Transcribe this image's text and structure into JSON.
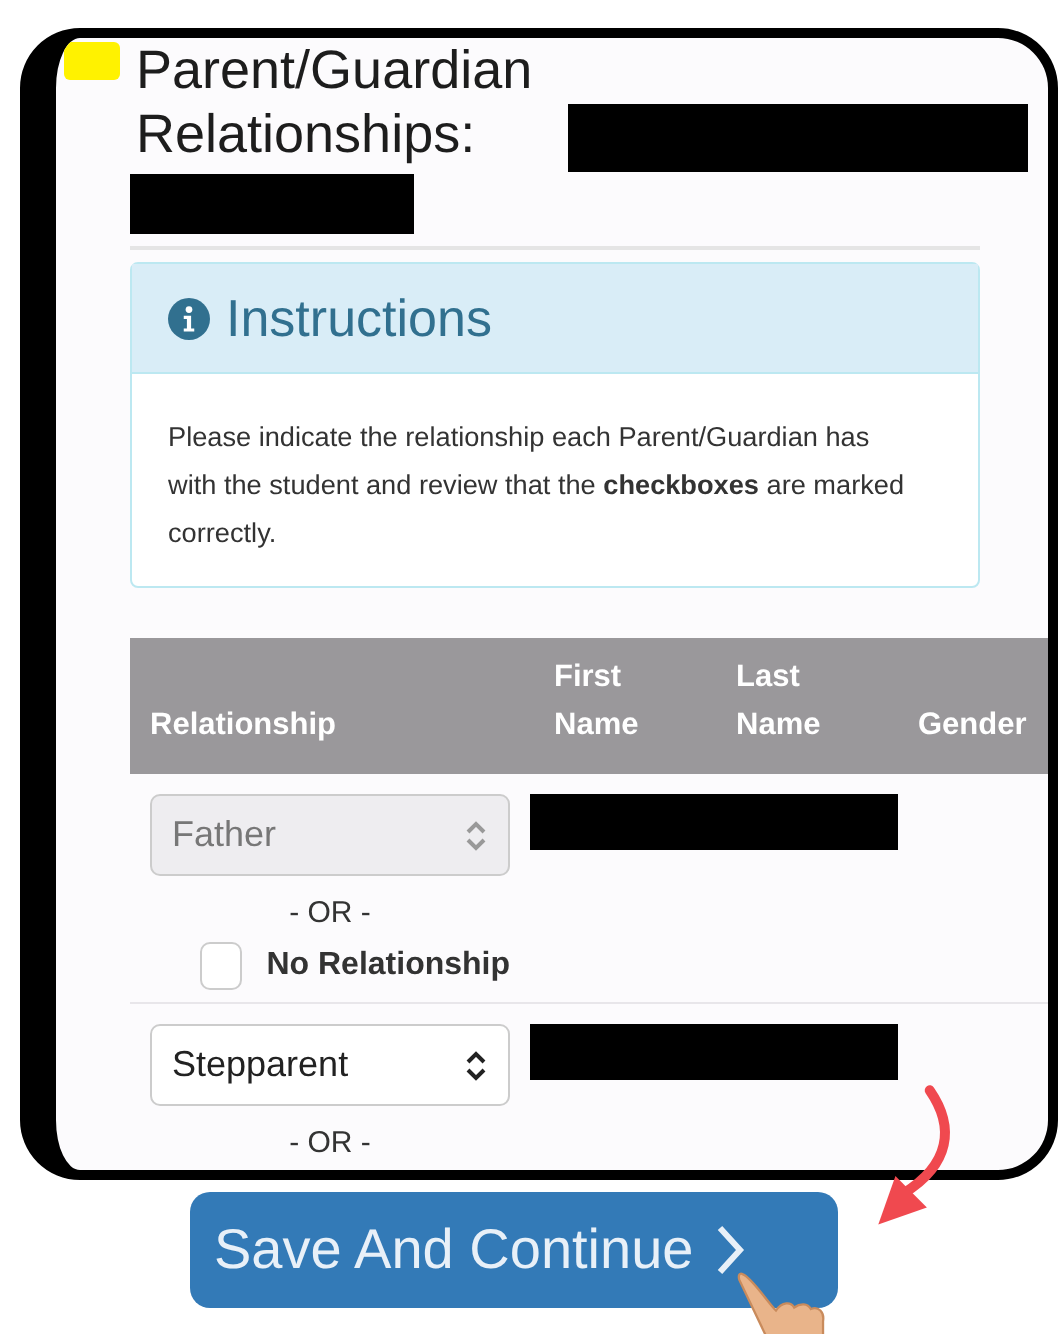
{
  "heading": "Parent/Guardian Relationships:",
  "instructions": {
    "title": "Instructions",
    "body": "Please indicate the relationship each Parent/Guardian has with the student and review that the **checkboxes** are marked correctly."
  },
  "table": {
    "columns": [
      "Relationship",
      "First Name",
      "Last Name",
      "Gender"
    ],
    "rows": [
      {
        "relationship": "Father",
        "disabled": true,
        "or": "- OR -",
        "no_relationship": {
          "label": "No Relationship",
          "checked": false
        }
      },
      {
        "relationship": "Stepparent",
        "disabled": false,
        "or": "- OR -"
      }
    ]
  },
  "save_button": {
    "label": "Save And Continue"
  }
}
